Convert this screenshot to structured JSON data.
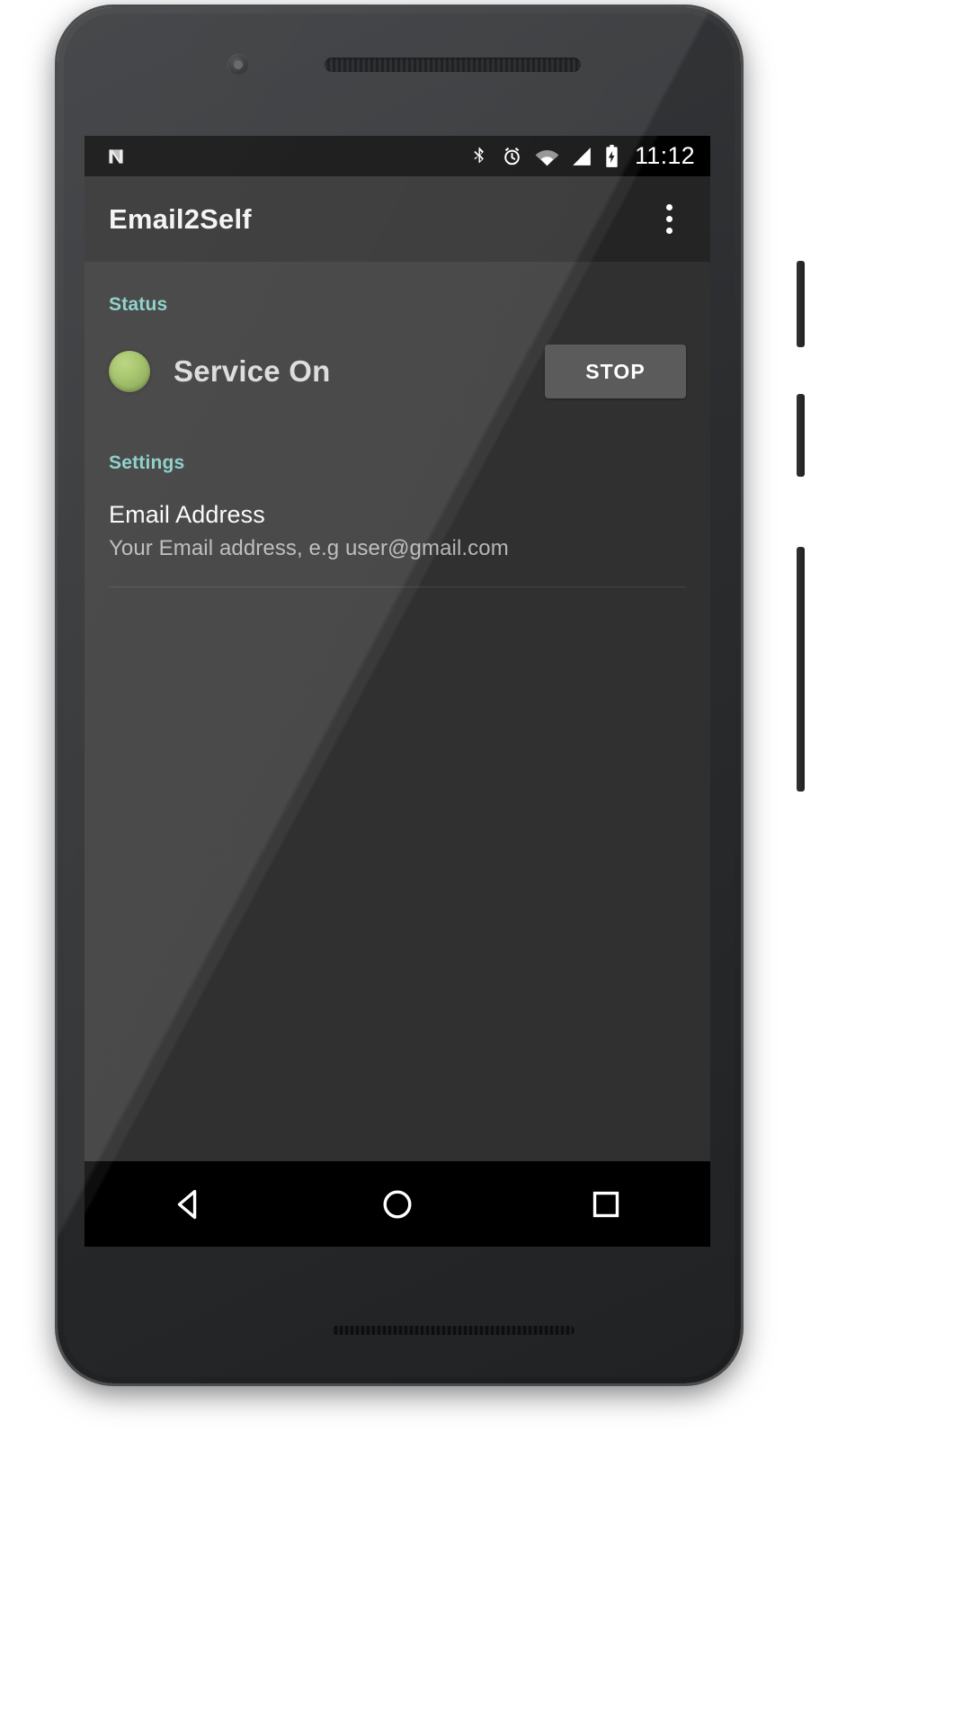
{
  "statusbar": {
    "android_logo": "android-n-logo",
    "icons": [
      {
        "name": "bluetooth-icon",
        "label": "Bluetooth"
      },
      {
        "name": "alarm-icon",
        "label": "Alarm set"
      },
      {
        "name": "wifi-icon",
        "label": "Wi-Fi"
      },
      {
        "name": "cellular-signal-icon",
        "label": "Cellular signal"
      },
      {
        "name": "battery-charging-icon",
        "label": "Battery charging"
      }
    ],
    "clock": "11:12"
  },
  "appbar": {
    "title": "Email2Self",
    "overflow_label": "More options"
  },
  "status_section": {
    "header": "Status",
    "indicator_color": "#9ec05c",
    "state_text": "Service On",
    "action_label": "STOP"
  },
  "settings_section": {
    "header": "Settings",
    "items": [
      {
        "title": "Email Address",
        "summary": "Your Email address, e.g user@gmail.com"
      }
    ]
  },
  "navbar": {
    "back_label": "Back",
    "home_label": "Home",
    "recents_label": "Recent apps"
  },
  "colors": {
    "accent": "#80cbc4",
    "background": "#303030",
    "appbar": "#242424",
    "button": "#5b5b5b"
  }
}
